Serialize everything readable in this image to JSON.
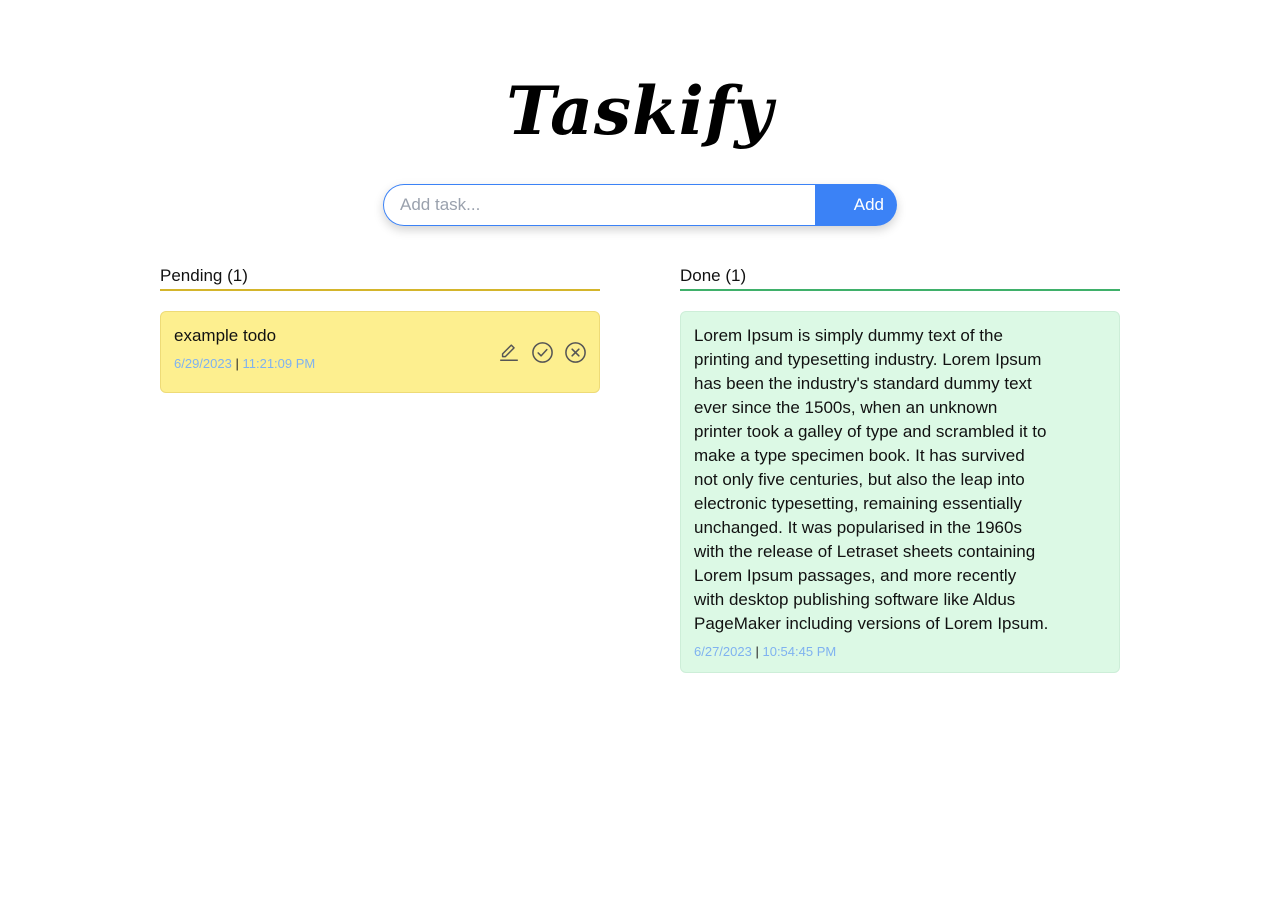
{
  "app": {
    "title": "Taskify"
  },
  "add_form": {
    "placeholder": "Add task...",
    "value": "",
    "button_label": "Add"
  },
  "columns": {
    "pending": {
      "title": "Pending (1)",
      "tasks": [
        {
          "text": "example todo",
          "date": "6/29/2023",
          "separator": "|",
          "time": "11:21:09 PM",
          "actions": [
            "edit-icon",
            "check-circle-icon",
            "close-circle-icon"
          ]
        }
      ]
    },
    "done": {
      "title": "Done (1)",
      "tasks": [
        {
          "text": "Lorem Ipsum is simply dummy text of the printing and typesetting industry. Lorem Ipsum has been the industry's standard dummy text ever since the 1500s, when an unknown printer took a galley of type and scrambled it to make a type specimen book. It has survived not only five centuries, but also the leap into electronic typesetting, remaining essentially unchanged. It was popularised in the 1960s with the release of Letraset sheets containing Lorem Ipsum passages, and more recently with desktop publishing software like Aldus PageMaker including versions of Lorem Ipsum.",
          "date": "6/27/2023",
          "separator": "|",
          "time": "10:54:45 PM"
        }
      ]
    }
  },
  "colors": {
    "accent": "#3b82f6",
    "pending_card": "#fdef8f",
    "pending_underline": "#d4b52b",
    "done_card": "#dcf9e5",
    "done_underline": "#3fb06a",
    "timestamp": "#7fb2f0"
  }
}
